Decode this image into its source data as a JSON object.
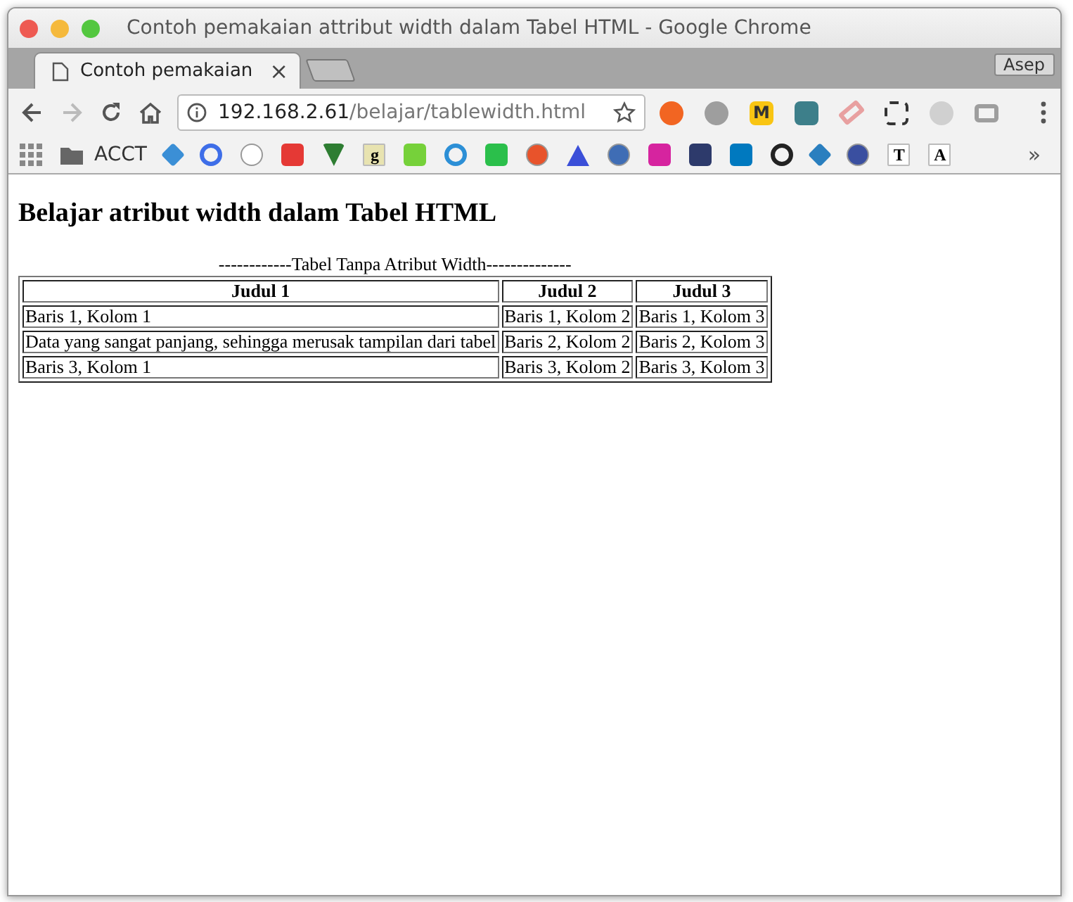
{
  "window": {
    "title": "Contoh pemakaian attribut width dalam Tabel HTML - Google Chrome"
  },
  "tabs": [
    {
      "label": "Contoh pemakaian",
      "selected": true,
      "close": "×"
    }
  ],
  "profile": "Asep",
  "address": {
    "host": "192.168.2.61",
    "path": "/belajar/tablewidth.html"
  },
  "extensions": [
    {
      "kind": "circle",
      "color": "#f26522"
    },
    {
      "kind": "circle",
      "color": "#9e9e9e"
    },
    {
      "kind": "letter",
      "text": "M",
      "color": "#f9c513"
    },
    {
      "kind": "square",
      "color": "#3d7f8a"
    },
    {
      "kind": "eraser",
      "color": "#e8a0a0"
    },
    {
      "kind": "crop",
      "color": "#333333"
    },
    {
      "kind": "circle",
      "color": "#d0d0d0"
    },
    {
      "kind": "camera",
      "color": "#9e9e9e"
    }
  ],
  "bookmarks": [
    {
      "kind": "apps",
      "color": "#888888"
    },
    {
      "kind": "folder",
      "color": "#666666",
      "label": "ACCT"
    },
    {
      "kind": "star",
      "color": "#3b8fd6"
    },
    {
      "kind": "ring",
      "color": "#3e6ee8"
    },
    {
      "kind": "circle",
      "color": "#ffffff"
    },
    {
      "kind": "square",
      "color": "#e53935"
    },
    {
      "kind": "check",
      "color": "#2e7d32"
    },
    {
      "kind": "letter",
      "color": "#e8e3b0",
      "text": "g"
    },
    {
      "kind": "square",
      "color": "#76d13a"
    },
    {
      "kind": "ring",
      "color": "#2c8fd6"
    },
    {
      "kind": "square",
      "color": "#2bbf4b"
    },
    {
      "kind": "circle",
      "color": "#e8532b"
    },
    {
      "kind": "triangle",
      "color": "#3b4fd8"
    },
    {
      "kind": "circle",
      "color": "#3f6db5"
    },
    {
      "kind": "square",
      "color": "#d6249f"
    },
    {
      "kind": "square",
      "color": "#2d3a6b"
    },
    {
      "kind": "square",
      "color": "#0079bf"
    },
    {
      "kind": "ring",
      "color": "#222222"
    },
    {
      "kind": "star",
      "color": "#2a7fbf"
    },
    {
      "kind": "circle",
      "color": "#3a4fa0"
    },
    {
      "kind": "letter",
      "color": "#ffffff",
      "text": "T"
    },
    {
      "kind": "letter",
      "color": "#ffffff",
      "text": "A"
    }
  ],
  "bookmarks_more": "»",
  "page": {
    "heading": "Belajar atribut width dalam Tabel HTML",
    "table": {
      "caption": "------------Tabel Tanpa Atribut Width--------------",
      "columns": [
        "Judul 1",
        "Judul 2",
        "Judul 3"
      ],
      "rows": [
        [
          "Baris 1, Kolom 1",
          "Baris 1, Kolom 2",
          "Baris 1, Kolom 3"
        ],
        [
          "Data yang sangat panjang, sehingga merusak tampilan dari tabel",
          "Baris 2, Kolom 2",
          "Baris 2, Kolom 3"
        ],
        [
          "Baris 3, Kolom 1",
          "Baris 3, Kolom 2",
          "Baris 3, Kolom 3"
        ]
      ]
    }
  }
}
